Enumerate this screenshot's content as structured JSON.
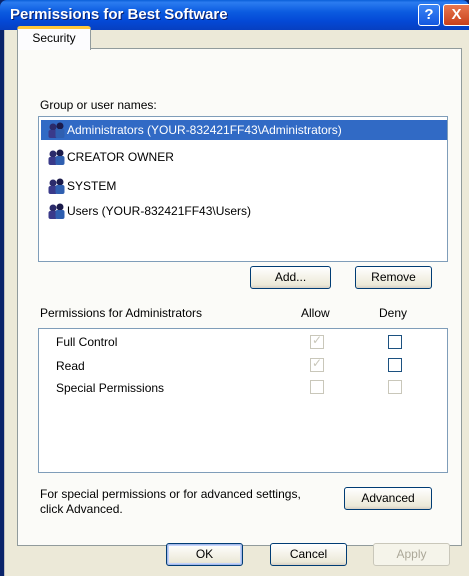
{
  "window": {
    "title": "Permissions for Best Software",
    "help_glyph": "?",
    "close_glyph": "X"
  },
  "tabs": [
    {
      "label": "Security",
      "selected": true
    }
  ],
  "group_label": "Group or user names:",
  "users": [
    {
      "name": "Administrators (YOUR-832421FF43\\Administrators)",
      "selected": true
    },
    {
      "name": "CREATOR OWNER",
      "selected": false
    },
    {
      "name": "SYSTEM",
      "selected": false
    },
    {
      "name": "Users (YOUR-832421FF43\\Users)",
      "selected": false
    }
  ],
  "buttons": {
    "add": "Add...",
    "remove": "Remove",
    "advanced": "Advanced",
    "ok": "OK",
    "cancel": "Cancel",
    "apply": "Apply"
  },
  "permissions": {
    "header": "Permissions for Administrators",
    "allow_header": "Allow",
    "deny_header": "Deny",
    "rows": [
      {
        "name": "Full Control",
        "allow": true,
        "allow_enabled": false,
        "deny": false,
        "deny_enabled": true
      },
      {
        "name": "Read",
        "allow": true,
        "allow_enabled": false,
        "deny": false,
        "deny_enabled": true
      },
      {
        "name": "Special Permissions",
        "allow": false,
        "allow_enabled": false,
        "deny": false,
        "deny_enabled": false
      }
    ]
  },
  "advanced_note_line1": "For special permissions or for advanced settings,",
  "advanced_note_line2": "click Advanced.",
  "colors": {
    "titlebar": "#0b5be0",
    "selection": "#316ac5",
    "tab_accent": "#ffc83c",
    "dialog_bg": "#ece9d8"
  }
}
